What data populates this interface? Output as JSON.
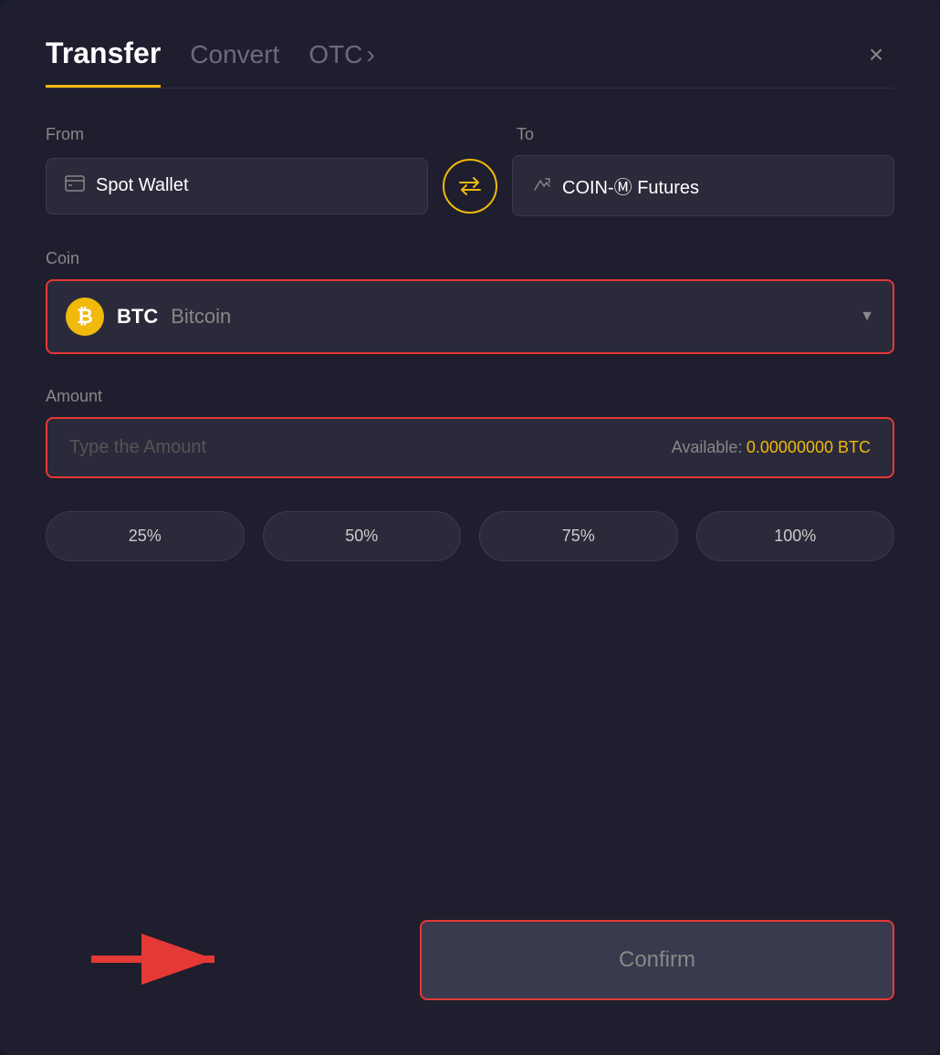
{
  "header": {
    "tab_transfer": "Transfer",
    "tab_convert": "Convert",
    "tab_otc": "OTC",
    "tab_otc_arrow": "›",
    "close_label": "×"
  },
  "from_to": {
    "from_label": "From",
    "to_label": "To",
    "from_wallet": "Spot Wallet",
    "to_wallet": "COIN-Ⓜ Futures",
    "swap_icon": "⇄"
  },
  "coin": {
    "label": "Coin",
    "symbol": "BTC",
    "name": "Bitcoin",
    "chevron": "▼"
  },
  "amount": {
    "label": "Amount",
    "placeholder": "Type the Amount",
    "available_label": "Available:",
    "available_value": "0.00000000 BTC"
  },
  "percentage_buttons": [
    {
      "label": "25%"
    },
    {
      "label": "50%"
    },
    {
      "label": "75%"
    },
    {
      "label": "100%"
    }
  ],
  "confirm_button": {
    "label": "Confirm"
  }
}
